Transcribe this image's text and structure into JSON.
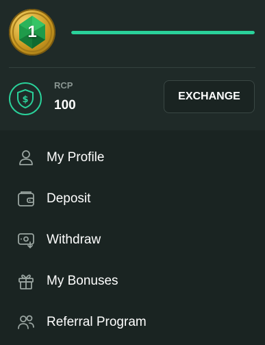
{
  "level": {
    "number": "1",
    "progress": 1.0
  },
  "rcp": {
    "label": "RCP",
    "value": "100",
    "exchange_label": "EXCHANGE"
  },
  "menu": {
    "items": [
      {
        "label": "My Profile",
        "icon": "user-icon"
      },
      {
        "label": "Deposit",
        "icon": "wallet-icon"
      },
      {
        "label": "Withdraw",
        "icon": "withdraw-icon"
      },
      {
        "label": "My Bonuses",
        "icon": "gift-icon"
      },
      {
        "label": "Referral Program",
        "icon": "users-icon"
      }
    ]
  },
  "colors": {
    "accent": "#2ad19a",
    "background": "#1a2422",
    "panel": "#1f2a28",
    "gold": "#d4a52a"
  }
}
